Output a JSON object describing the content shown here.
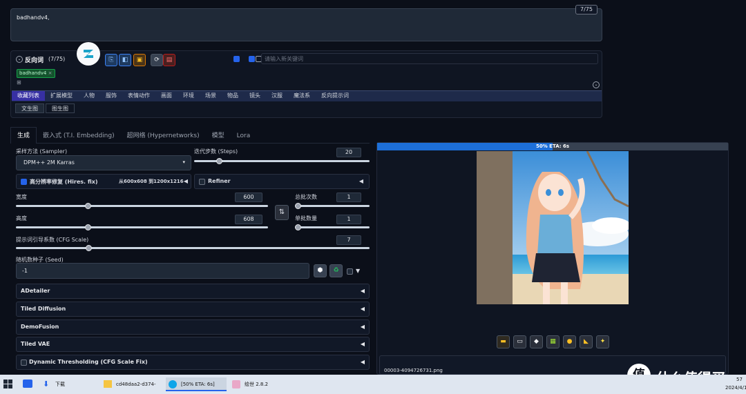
{
  "prompt": {
    "text": "badhandv4,",
    "token_count": "7/75"
  },
  "negative": {
    "title": "反向词",
    "count": "(7/75)",
    "search_placeholder": "请输入新关键词",
    "tag": "badhandv4",
    "tag_close": "×"
  },
  "category_tabs": [
    "收藏列表",
    "扩展模型",
    "人物",
    "服饰",
    "表情动作",
    "画面",
    "环境",
    "场景",
    "物品",
    "镜头",
    "汉服",
    "魔法系",
    "反向提示词"
  ],
  "sub_tabs": [
    "文生图",
    "图生图"
  ],
  "main_tabs": [
    "生成",
    "嵌入式 (T.I. Embedding)",
    "超网络 (Hypernetworks)",
    "模型",
    "Lora"
  ],
  "sampler": {
    "label": "采样方法 (Sampler)",
    "value": "DPM++ 2M Karras"
  },
  "steps": {
    "label": "迭代步数 (Steps)",
    "value": "20",
    "fraction": 0.13
  },
  "hires": {
    "label": "高分辨率修复 (Hires. fix)",
    "info": "从600x608 到1200x1216",
    "arrow": "◀"
  },
  "refiner": {
    "label": "Refiner",
    "arrow": "◀"
  },
  "width": {
    "label": "宽度",
    "value": "600",
    "fraction": 0.28
  },
  "height": {
    "label": "高度",
    "value": "608",
    "fraction": 0.28
  },
  "swap_icon": "⇅",
  "batch_count": {
    "label": "总批次数",
    "value": "1",
    "fraction": 0.0
  },
  "batch_size": {
    "label": "单批数量",
    "value": "1",
    "fraction": 0.0
  },
  "cfg": {
    "label": "提示词引导系数 (CFG Scale)",
    "value": "7",
    "fraction": 0.2
  },
  "seed": {
    "label": "随机数种子 (Seed)",
    "value": "-1"
  },
  "accordions": [
    {
      "label": "ADetailer",
      "arrow": "◀"
    },
    {
      "label": "Tiled Diffusion",
      "arrow": "◀"
    },
    {
      "label": "DemoFusion",
      "arrow": "◀"
    },
    {
      "label": "Tiled VAE",
      "arrow": "◀"
    },
    {
      "label": "Dynamic Thresholding (CFG Scale Fix)",
      "arrow": "◀"
    }
  ],
  "progress": {
    "text": "50% ETA: 6s",
    "fraction": 0.5
  },
  "output": {
    "filename": "00003-4094726731.png"
  },
  "taskbar": {
    "items": [
      "下载",
      "cd48daa2-d374-4...",
      "[50% ETA: 6s] Sta...",
      "绘世 2.8.2"
    ],
    "clock_time": "57",
    "clock_date": "2024/4/1"
  },
  "watermark": "什么值得买",
  "colors": {
    "accent": "#1d6fd8",
    "tab_active": "#3730a3",
    "progress": "#1d6fd8"
  }
}
